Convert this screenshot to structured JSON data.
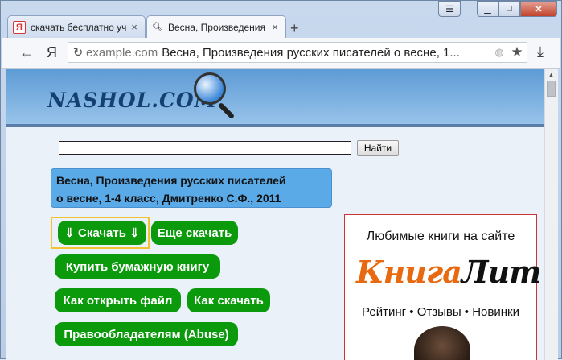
{
  "browser": {
    "tabs": [
      {
        "icon": "yandex-favicon",
        "title": "скачать бесплатно уч",
        "active": false
      },
      {
        "icon": "search-favicon",
        "title": "Весна, Произведения",
        "active": true
      }
    ],
    "new_tab_symbol": "+",
    "address": {
      "host": "example.com",
      "page_title": "Весна, Произведения русских писателей о весне, 1..."
    },
    "yandex_glyph": "Я"
  },
  "site": {
    "logo_text": "NASHOL.COM",
    "search_button": "Найти",
    "book_title_line1": "Весна, Произведения русских писателей",
    "book_title_line2": "о весне, 1-4 класс, Дмитренко С.Ф., 2011",
    "buttons": {
      "download": "⇓ Скачать ⇓",
      "more_download": "Еще скачать",
      "buy_paper": "Купить бумажную книгу",
      "how_open": "Как открыть файл",
      "how_download": "Как скачать",
      "abuse": "Правообладателям (Abuse)"
    },
    "ad": {
      "tagline": "Любимые книги на сайте",
      "brand_part1": "Книга",
      "brand_part2": "Лит",
      "features": "Рейтинг • Отзывы • Новинки"
    }
  },
  "colors": {
    "button_green": "#0b9a0b",
    "title_box_blue": "#5aaae8",
    "header_blue": "#5d9bd5",
    "brand_orange": "#e86a10"
  }
}
